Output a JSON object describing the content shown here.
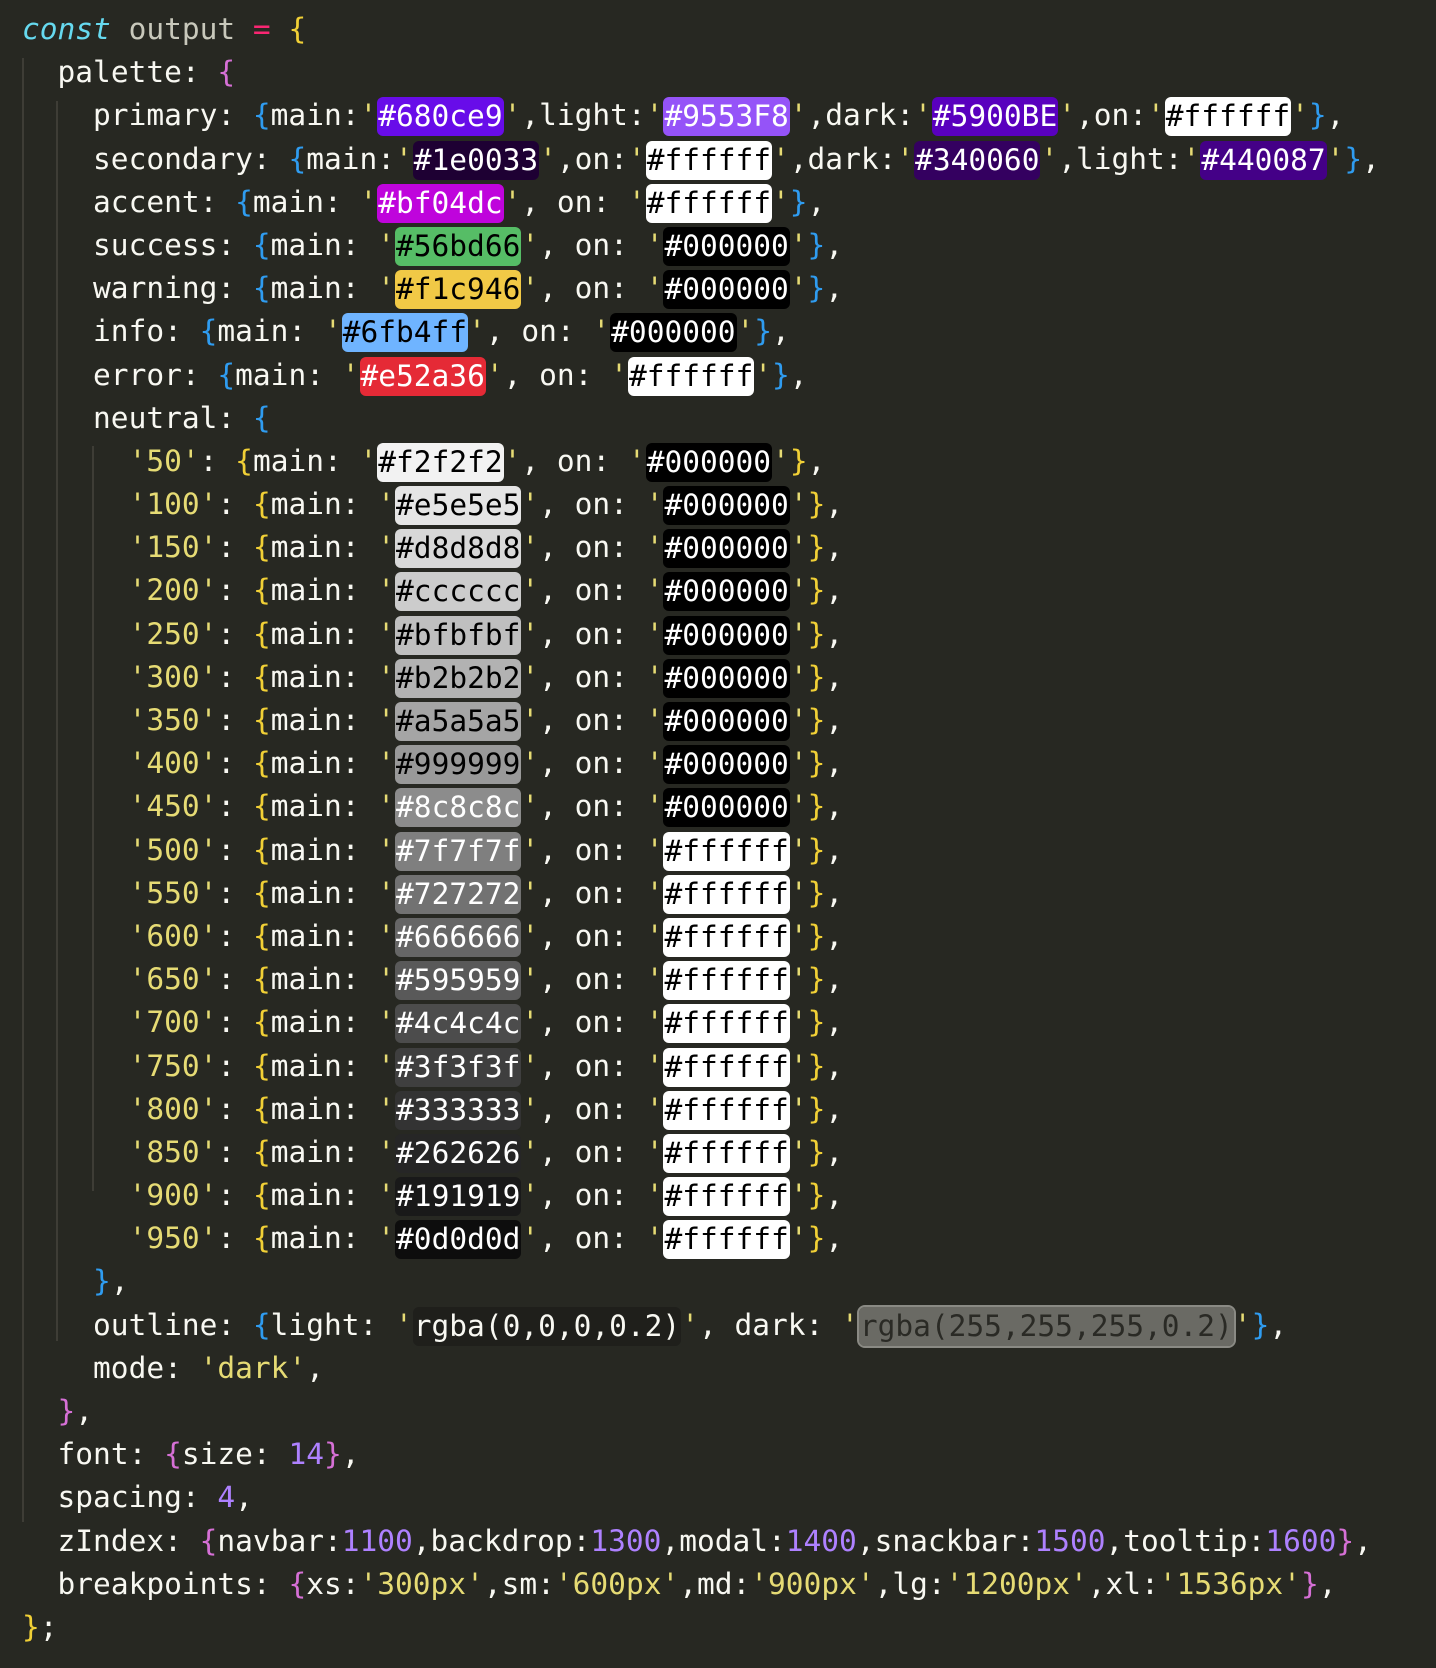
{
  "code": {
    "const_keyword": "const",
    "variable_name": "output",
    "palette_key": "palette",
    "primary": {
      "key": "primary",
      "main": "#680ce9",
      "light": "#9553F8",
      "dark": "#5900BE",
      "on": "#ffffff"
    },
    "secondary": {
      "key": "secondary",
      "main": "#1e0033",
      "on": "#ffffff",
      "dark": "#340060",
      "light": "#440087"
    },
    "accent": {
      "key": "accent",
      "main": "#bf04dc",
      "on": "#ffffff"
    },
    "success": {
      "key": "success",
      "main": "#56bd66",
      "on": "#000000"
    },
    "warning": {
      "key": "warning",
      "main": "#f1c946",
      "on": "#000000"
    },
    "info": {
      "key": "info",
      "main": "#6fb4ff",
      "on": "#000000"
    },
    "error": {
      "key": "error",
      "main": "#e52a36",
      "on": "#ffffff"
    },
    "neutral_key": "neutral",
    "neutral": [
      {
        "shade": "50",
        "main": "#f2f2f2",
        "on": "#000000"
      },
      {
        "shade": "100",
        "main": "#e5e5e5",
        "on": "#000000"
      },
      {
        "shade": "150",
        "main": "#d8d8d8",
        "on": "#000000"
      },
      {
        "shade": "200",
        "main": "#cccccc",
        "on": "#000000"
      },
      {
        "shade": "250",
        "main": "#bfbfbf",
        "on": "#000000"
      },
      {
        "shade": "300",
        "main": "#b2b2b2",
        "on": "#000000"
      },
      {
        "shade": "350",
        "main": "#a5a5a5",
        "on": "#000000"
      },
      {
        "shade": "400",
        "main": "#999999",
        "on": "#000000"
      },
      {
        "shade": "450",
        "main": "#8c8c8c",
        "on": "#000000"
      },
      {
        "shade": "500",
        "main": "#7f7f7f",
        "on": "#ffffff"
      },
      {
        "shade": "550",
        "main": "#727272",
        "on": "#ffffff"
      },
      {
        "shade": "600",
        "main": "#666666",
        "on": "#ffffff"
      },
      {
        "shade": "650",
        "main": "#595959",
        "on": "#ffffff"
      },
      {
        "shade": "700",
        "main": "#4c4c4c",
        "on": "#ffffff"
      },
      {
        "shade": "750",
        "main": "#3f3f3f",
        "on": "#ffffff"
      },
      {
        "shade": "800",
        "main": "#333333",
        "on": "#ffffff"
      },
      {
        "shade": "850",
        "main": "#262626",
        "on": "#ffffff"
      },
      {
        "shade": "900",
        "main": "#191919",
        "on": "#ffffff"
      },
      {
        "shade": "950",
        "main": "#0d0d0d",
        "on": "#ffffff"
      }
    ],
    "outline": {
      "key": "outline",
      "light": "rgba(0,0,0,0.2)",
      "dark": "rgba(255,255,255,0.2)"
    },
    "mode": {
      "key": "mode",
      "value": "dark"
    },
    "font": {
      "key": "font",
      "size_key": "size",
      "size": "14"
    },
    "spacing": {
      "key": "spacing",
      "value": "4"
    },
    "zIndex": {
      "key": "zIndex",
      "navbar": "1100",
      "backdrop": "1300",
      "modal": "1400",
      "snackbar": "1500",
      "tooltip": "1600"
    },
    "breakpoints": {
      "key": "breakpoints",
      "xs": "300px",
      "sm": "600px",
      "md": "900px",
      "lg": "1200px",
      "xl": "1536px"
    }
  }
}
